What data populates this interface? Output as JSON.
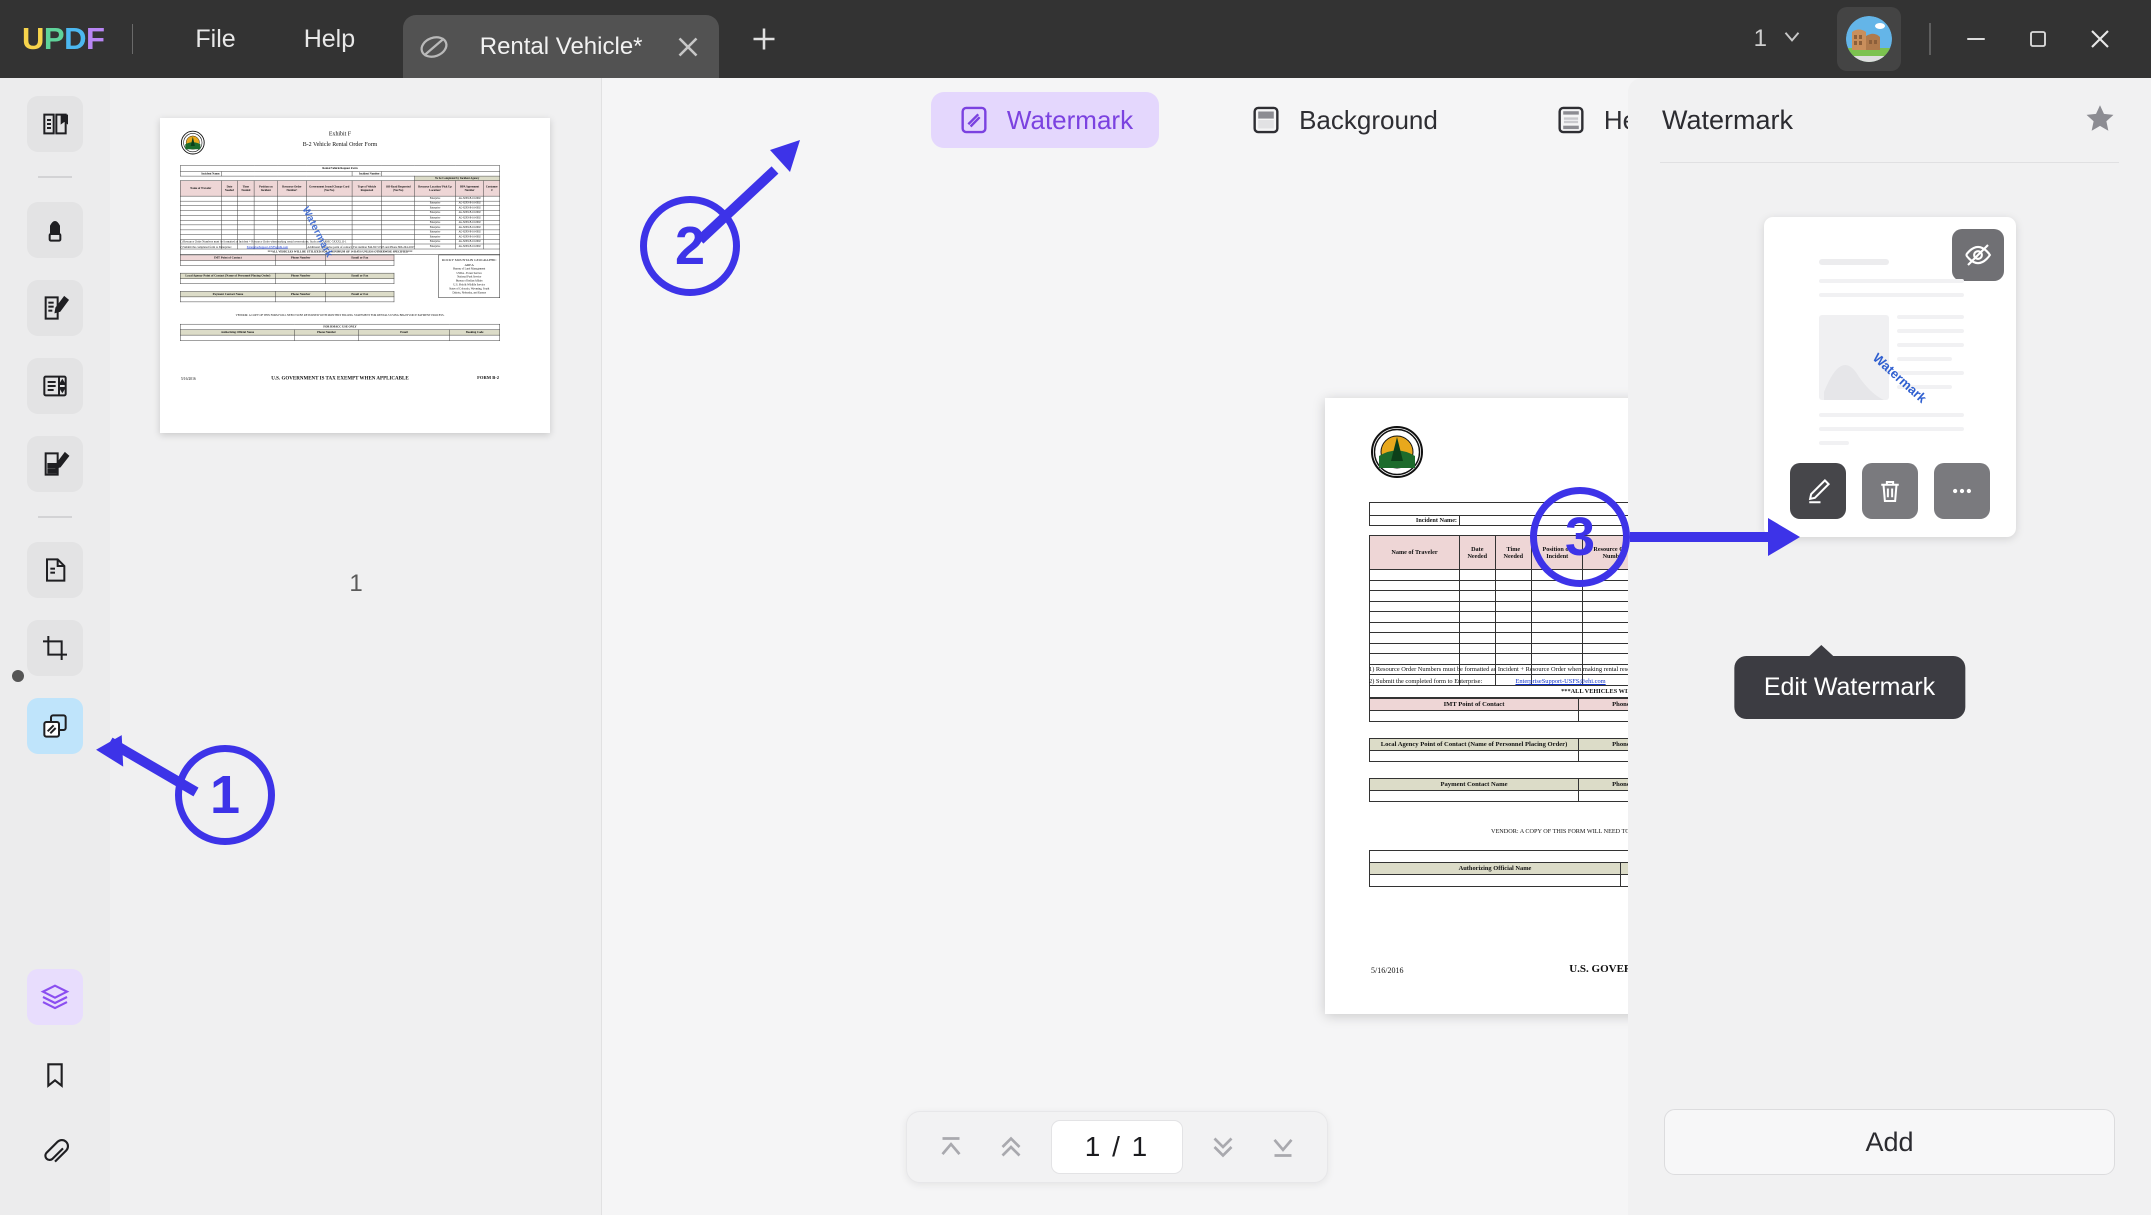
{
  "app": {
    "logo_letters": [
      {
        "ch": "U",
        "color": "#f7d44c"
      },
      {
        "ch": "P",
        "color": "#5fd39a"
      },
      {
        "ch": "D",
        "color": "#4cb8f0"
      },
      {
        "ch": "F",
        "color": "#b986f5"
      }
    ],
    "menus": [
      "File",
      "Help"
    ],
    "tab_title": "Rental Vehicle*",
    "tab_icon": "watermark-icon",
    "new_tab_icon": "plus-icon",
    "page_indicator": "1",
    "chevron_icon": "chevron-down-icon",
    "avatar_name": "user-avatar",
    "window_controls": [
      "minimize",
      "maximize",
      "close"
    ]
  },
  "sidebar": {
    "items": [
      {
        "name": "reader",
        "icon": "book-reader-icon",
        "state": "normal"
      },
      {
        "name": "annotate",
        "icon": "highlighter-icon",
        "state": "normal"
      },
      {
        "name": "edit-pdf",
        "icon": "edit-document-icon",
        "state": "normal"
      },
      {
        "name": "page-side",
        "icon": "compare-pages-icon",
        "state": "normal"
      },
      {
        "name": "fill-sign",
        "icon": "sign-document-icon",
        "state": "normal"
      },
      {
        "name": "convert",
        "icon": "convert-file-icon",
        "state": "normal"
      },
      {
        "name": "crop-pages",
        "icon": "crop-icon",
        "state": "normal"
      },
      {
        "name": "watermark",
        "icon": "watermark-layers-icon",
        "state": "active-blue"
      },
      {
        "name": "layers",
        "icon": "layers-stack-icon",
        "state": "active-purple"
      },
      {
        "name": "bookmarks",
        "icon": "bookmark-icon",
        "state": "plain"
      },
      {
        "name": "attachments",
        "icon": "paperclip-icon",
        "state": "plain"
      }
    ]
  },
  "thumbnails": {
    "page_label": "1"
  },
  "mode_bar": {
    "tabs": [
      {
        "label": "Watermark",
        "icon": "watermark-icon",
        "active": true
      },
      {
        "label": "Background",
        "icon": "background-icon",
        "active": false
      },
      {
        "label": "Header & Footer",
        "icon": "header-footer-icon",
        "active": false
      }
    ]
  },
  "right_panel": {
    "title": "Watermark",
    "favorite_icon": "star-icon",
    "card": {
      "visibility_icon": "eye-off-icon",
      "actions": [
        {
          "name": "edit",
          "icon": "pencil-icon",
          "highlighted": true
        },
        {
          "name": "delete",
          "icon": "trash-icon",
          "highlighted": false
        },
        {
          "name": "more",
          "icon": "ellipsis-icon",
          "highlighted": false
        }
      ],
      "watermark_preview_text": "Watermark"
    },
    "tooltip": "Edit Watermark",
    "add_label": "Add"
  },
  "page_nav": {
    "first_icon": "go-first-icon",
    "prev_icon": "go-prev-icon",
    "value": "1 / 1",
    "next_icon": "go-next-icon",
    "last_icon": "go-last-icon"
  },
  "annotations": [
    {
      "number": "1",
      "target": "sidebar-watermark-button"
    },
    {
      "number": "2",
      "target": "watermark-mode-tab"
    },
    {
      "number": "3",
      "target": "edit-watermark-button"
    }
  ],
  "document": {
    "exhibit": "Exhibit F",
    "title": "B-2 Vehicle Rental Order Form",
    "form_band": "Rental Vehicle Request Form",
    "incident_name_label": "Incident Name:",
    "incident_number_label": "Incident Number:",
    "agency_band": "To be Completed by Incident Agency",
    "columns": [
      "Name of Traveler",
      "Date Needed",
      "Time Needed",
      "Position on Incident",
      "Resource Order Number¹",
      "Government Issued Charge Card (Yes/No)",
      "Type of Vehicle Requested",
      "Off-Road Requested (Yes/No)",
      "Resource Location/ Pick Up Location²",
      "BPA Agreement Number",
      "Customer #"
    ],
    "rows": [
      {
        "vendor": "Enterprise",
        "bpa": "AG-82X9-B-16-0002"
      },
      {
        "vendor": "Enterprise",
        "bpa": "AG-82X9-B-16-0002"
      },
      {
        "vendor": "Enterprise",
        "bpa": "AG-82X9-B-16-0002"
      },
      {
        "vendor": "Enterprise",
        "bpa": "AG-82X9-B-16-0002"
      },
      {
        "vendor": "Enterprise",
        "bpa": "AG-82X9-B-16-0002"
      },
      {
        "vendor": "Enterprise",
        "bpa": "AG-82X9-B-16-0002"
      },
      {
        "vendor": "Enterprise",
        "bpa": "AG-82X9-B-16-0002"
      },
      {
        "vendor": "Enterprise",
        "bpa": "AG-82X9-B-16-0002"
      },
      {
        "vendor": "Enterprise",
        "bpa": "AG-82X9-B-16-0002"
      },
      {
        "vendor": "Enterprise",
        "bpa": "AG-82X9-B-16-0002"
      },
      {
        "vendor": "Enterprise",
        "bpa": "AG-82X9-B-16-0002"
      }
    ],
    "all_vehicles_note": "***ALL VEHICLES WILL BE UTILIZED FOR A MINIMUM OF 14 DAYS UNLESS OTHERWISE SPECIFIED***",
    "note1": "1) Resource Order Numbers must be formatted as Incident + Resource Order when making rental reservations. Such as CO-RMC-5XXX1.O-1",
    "note2_prefix": "2) Submit the completed form to Enterprise:",
    "note2_email": "EnterpriseSupport-USFS@ehi.com",
    "note2_suffix": "Additional Enterprise point of contact:   Fax number 844-827-0323 and Phone 866-264-2027",
    "contact_tables": [
      {
        "style": "pink",
        "headers": [
          "IMT Point of Contact",
          "Phone Number",
          "Email or Fax"
        ]
      },
      {
        "style": "olive",
        "headers": [
          "Local Agency Point of Contact (Name of Personnel Placing Order)",
          "Phone Number",
          "Email or Fax"
        ]
      },
      {
        "style": "olive",
        "headers": [
          "Payment Contact Name",
          "Phone Number",
          "Email or Fax"
        ]
      }
    ],
    "rm_box": {
      "line1": "ROCKY MOUNTAIN GEOGRAPHIC",
      "line2": "AREA",
      "lines": [
        "Bureau of Land Management",
        "USDA - Forest Service",
        "National Park Service",
        "Bureau of Indian Affairs",
        "U.S. Fish & Wildlife Service",
        "States of Colorado, Wyoming, South",
        "Dakota, Nebraska, and Kansas"
      ]
    },
    "vendor_note": "VENDOR: A COPY OF THIS FORM WILL NEED TO BE RETURNED WITH MONTHLY BILLING STATEMENT FOR RENTALS USING BPA INVOICE PAYMENT PROCESS.",
    "rmacc_band": "FOR RMACC USE ONLY",
    "rmacc_headers": [
      "Authorizing Official Name",
      "Phone Number",
      "Email",
      "Booking Code"
    ],
    "footer_date": "5/16/2016",
    "footer_center": "U.S. GOVERNMENT IS TAX EXEMPT WHEN APPLICABLE",
    "footer_form": "FORM B-2",
    "watermark_text": "Watermark"
  }
}
